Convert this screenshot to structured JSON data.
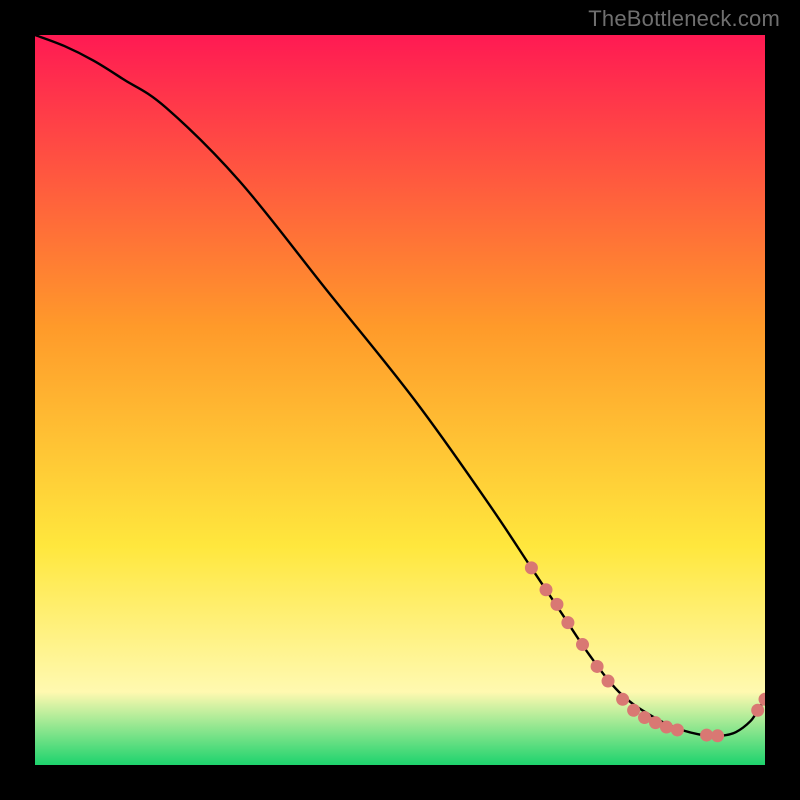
{
  "watermark": "TheBottleneck.com",
  "colors": {
    "background": "#000000",
    "dot": "#d97873",
    "line": "#000000",
    "gradient_red": "#ff1a53",
    "gradient_orange": "#ff9a2a",
    "gradient_yellow": "#ffe73d",
    "gradient_pale_yellow": "#fff9b0",
    "gradient_green": "#1dd36d"
  },
  "chart_data": {
    "type": "line",
    "title": "",
    "xlabel": "",
    "ylabel": "",
    "xlim": [
      0,
      100
    ],
    "ylim": [
      0,
      100
    ],
    "note": "Bottleneck-style curve. Percent values estimated from pixel positions; axes unlabeled in source image.",
    "series": [
      {
        "name": "curve",
        "x": [
          0,
          4,
          8,
          12,
          18,
          28,
          40,
          52,
          62,
          68,
          72,
          76,
          80,
          84,
          88,
          92,
          94,
          96,
          98,
          99,
          100
        ],
        "y": [
          100,
          98.5,
          96.5,
          94,
          90,
          80,
          65,
          50,
          36,
          27,
          21,
          15,
          10,
          7,
          5,
          4,
          4,
          4.5,
          6,
          7.5,
          9
        ]
      }
    ],
    "highlighted_points": {
      "name": "dots",
      "x": [
        68,
        70,
        71.5,
        73,
        75,
        77,
        78.5,
        80.5,
        82,
        83.5,
        85,
        86.5,
        88,
        92,
        93.5,
        99,
        100
      ],
      "y": [
        27,
        24,
        22,
        19.5,
        16.5,
        13.5,
        11.5,
        9,
        7.5,
        6.5,
        5.8,
        5.2,
        4.8,
        4.1,
        4.0,
        7.5,
        9
      ]
    }
  }
}
